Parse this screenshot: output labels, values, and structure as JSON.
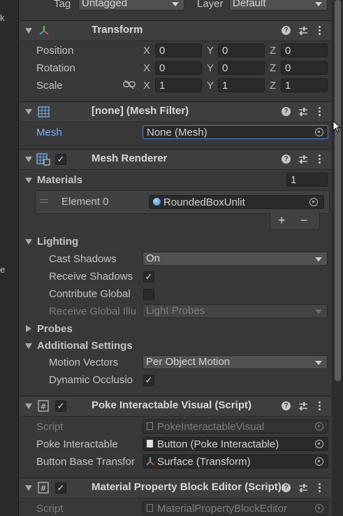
{
  "left_strip": {
    "letters": [
      "k",
      "e"
    ]
  },
  "top": {
    "tag_label": "Tag",
    "tag_value": "Untagged",
    "layer_label": "Layer",
    "layer_value": "Default"
  },
  "transform": {
    "title": "Transform",
    "position_label": "Position",
    "rotation_label": "Rotation",
    "scale_label": "Scale",
    "x": "X",
    "y": "Y",
    "z": "Z",
    "position": [
      "0",
      "0",
      "0"
    ],
    "rotation": [
      "0",
      "0",
      "0"
    ],
    "scale": [
      "1",
      "1",
      "1"
    ]
  },
  "mesh_filter": {
    "title": "[none] (Mesh Filter)",
    "mesh_label": "Mesh",
    "mesh_value": "None (Mesh)"
  },
  "mesh_renderer": {
    "title": "Mesh Renderer",
    "materials_label": "Materials",
    "materials_count": "1",
    "element_label": "Element 0",
    "element_value": "RoundedBoxUnlit",
    "plus": "+",
    "minus": "−",
    "lighting_label": "Lighting",
    "cast_shadows_label": "Cast Shadows",
    "cast_shadows_value": "On",
    "receive_shadows_label": "Receive Shadows",
    "contribute_global_label": "Contribute Global",
    "receive_global_label": "Receive Global Illu",
    "receive_global_value": "Light Probes",
    "probes_label": "Probes",
    "additional_label": "Additional Settings",
    "motion_vectors_label": "Motion Vectors",
    "motion_vectors_value": "Per Object Motion",
    "dynamic_occlusion_label": "Dynamic Occlusio"
  },
  "poke_visual": {
    "title": "Poke Interactable Visual (Script)",
    "script_label": "Script",
    "script_value": "PokeInteractableVisual",
    "poke_label": "Poke Interactable",
    "poke_value": "Button (Poke Interactable)",
    "base_label": "Button Base Transfor",
    "base_value": "Surface (Transform)"
  },
  "mpb_editor": {
    "title": "Material Property Block Editor (Script)",
    "script_label": "Script",
    "script_value": "MaterialPropertyBlockEditor"
  },
  "glyphs": {
    "check": "✓",
    "help": "?",
    "unlink": "⛓"
  },
  "colors": {
    "background": "#383838",
    "header": "#3e3e3e",
    "field": "#2a2a2a",
    "link_label": "#7fb0ff",
    "selected_border": "#4a86d4"
  }
}
